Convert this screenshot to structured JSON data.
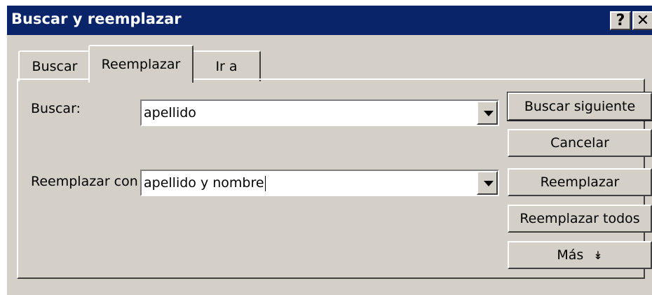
{
  "window": {
    "title": "Buscar y reemplazar",
    "help_glyph": "?",
    "close_glyph": "✕"
  },
  "tabs": [
    {
      "label": "Buscar",
      "selected": false
    },
    {
      "label": "Reemplazar",
      "selected": true
    },
    {
      "label": "Ir a",
      "selected": false
    }
  ],
  "find": {
    "label": "Buscar:",
    "value": "apellido"
  },
  "replace": {
    "label": "Reemplazar con",
    "value": "apellido y nombre"
  },
  "buttons": {
    "find_next": "Buscar siguiente",
    "cancel": "Cancelar",
    "replace": "Reemplazar",
    "replace_all": "Reemplazar todos",
    "more": "Más",
    "more_glyph": "↡"
  },
  "colors": {
    "title_bar": "#0a246a",
    "face": "#d4d0c8"
  }
}
